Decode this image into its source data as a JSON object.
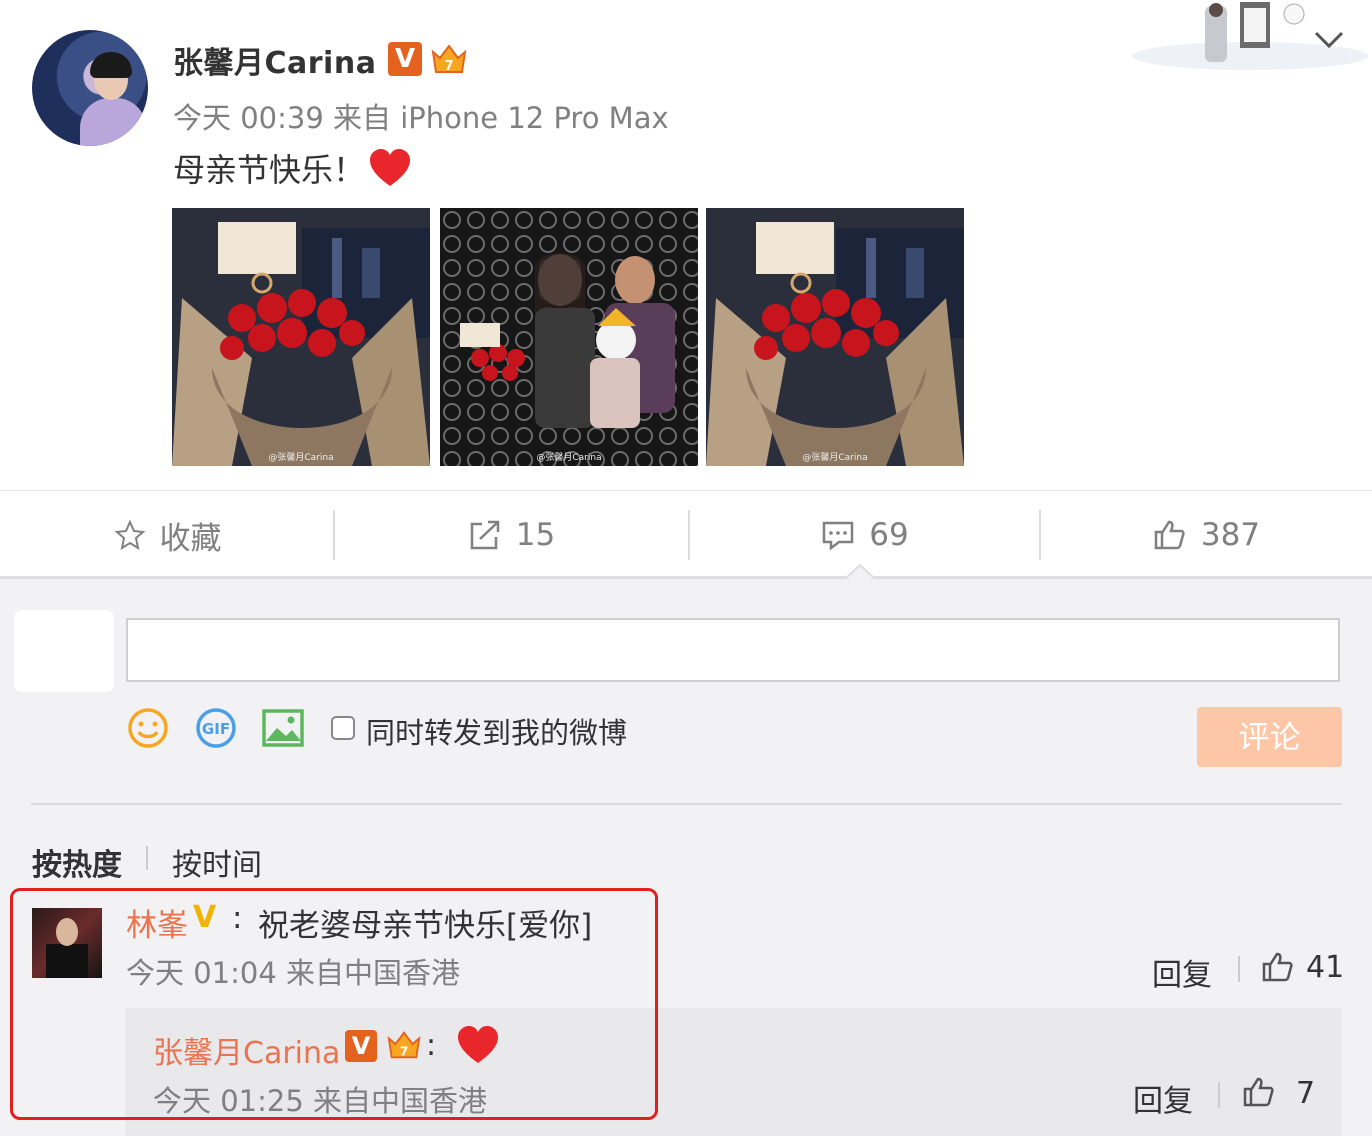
{
  "post": {
    "author": "张馨月Carina",
    "meta": "今天 00:39 来自 iPhone 12 Pro Max",
    "text": "母亲节快乐！",
    "photo_watermark": "@张馨月Carina"
  },
  "actions": {
    "favorite": "收藏",
    "repost_count": "15",
    "comment_count": "69",
    "like_count": "387"
  },
  "composer": {
    "input_placeholder": "",
    "forward_label": "同时转发到我的微博",
    "submit_label": "评论"
  },
  "sort": {
    "by_hot": "按热度",
    "by_time": "按时间"
  },
  "comments": [
    {
      "user": "林峯",
      "text": "祝老婆母亲节快乐[爱你]",
      "meta": "今天 01:04 来自中国香港",
      "reply_label": "回复",
      "likes": "41",
      "replies": [
        {
          "user": "张馨月Carina",
          "meta": "今天 01:25 来自中国香港",
          "reply_label": "回复",
          "likes": "7"
        }
      ]
    }
  ],
  "colors": {
    "username": "#eb7350",
    "button": "#fdc7a7",
    "highlight": "#e0201d",
    "verified_orange": "#e2621e",
    "verified_yellow": "#f0b400"
  },
  "icons": [
    "star-icon",
    "repost-icon",
    "comment-icon",
    "thumbs-up-icon",
    "smiley-icon",
    "gif-icon",
    "image-icon",
    "heart-icon",
    "chevron-down-icon"
  ]
}
